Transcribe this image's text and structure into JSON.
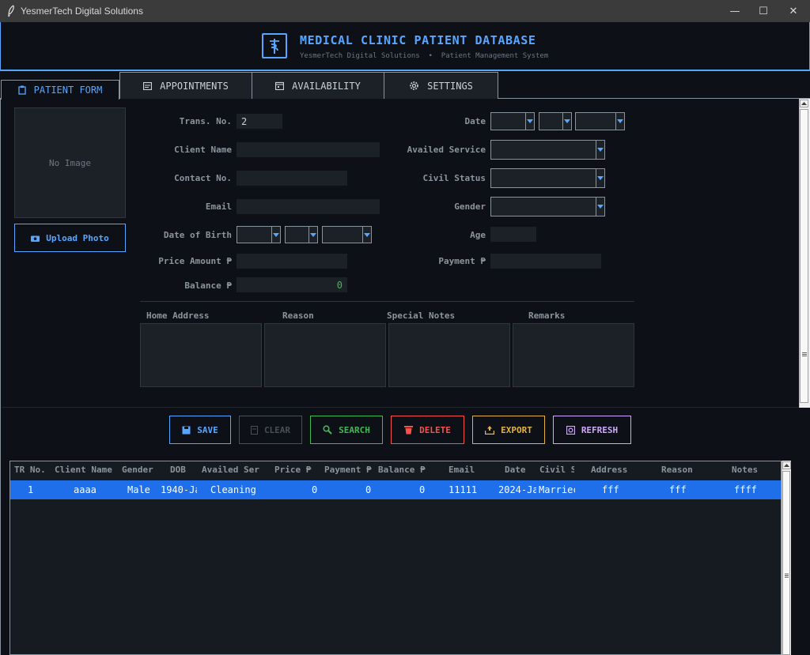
{
  "window": {
    "title": "YesmerTech Digital Solutions",
    "minimize": "—",
    "maximize": "☐",
    "close": "✕"
  },
  "header": {
    "title": "MEDICAL CLINIC PATIENT DATABASE",
    "subtitle": "YesmerTech Digital Solutions  •  Patient Management System"
  },
  "tabs": [
    {
      "label": "PATIENT FORM",
      "icon": "clipboard-icon"
    },
    {
      "label": "APPOINTMENTS",
      "icon": "card-icon"
    },
    {
      "label": "AVAILABILITY",
      "icon": "calendar-icon"
    },
    {
      "label": "SETTINGS",
      "icon": "gear-icon"
    }
  ],
  "photo": {
    "placeholder": "No Image",
    "upload_label": "Upload Photo"
  },
  "form": {
    "trans_no": {
      "label": "Trans. No.",
      "value": "2"
    },
    "client_name": {
      "label": "Client Name",
      "value": ""
    },
    "contact_no": {
      "label": "Contact No.",
      "value": ""
    },
    "email": {
      "label": "Email",
      "value": ""
    },
    "dob": {
      "label": "Date of Birth"
    },
    "price_amount": {
      "label": "Price Amount ₱",
      "value": ""
    },
    "balance": {
      "label": "Balance ₱",
      "value": "0"
    },
    "date": {
      "label": "Date"
    },
    "availed_service": {
      "label": "Availed Service"
    },
    "civil_status": {
      "label": "Civil Status"
    },
    "gender": {
      "label": "Gender"
    },
    "age": {
      "label": "Age",
      "value": ""
    },
    "payment": {
      "label": "Payment ₱",
      "value": ""
    }
  },
  "text_areas": {
    "home_address": "Home Address",
    "reason": "Reason",
    "special_notes": "Special Notes",
    "remarks": "Remarks"
  },
  "actions": {
    "save": "SAVE",
    "clear": "CLEAR",
    "search": "SEARCH",
    "delete": "DELETE",
    "export": "EXPORT",
    "refresh": "REFRESH"
  },
  "colors": {
    "accent": "#58a6ff",
    "save": "#58a6ff",
    "clear": "#484f58",
    "search": "#3fb950",
    "delete": "#f85149",
    "export": "#e3b341",
    "refresh": "#d2a8ff",
    "selected_row": "#1f6feb"
  },
  "table": {
    "columns": [
      "TR No.",
      "Client Name",
      "Gender",
      "DOB",
      "Availed Ser",
      "Price ₱",
      "Payment ₱",
      "Balance ₱",
      "Email",
      "Date",
      "Civil S",
      "Address",
      "Reason",
      "Notes"
    ],
    "rows": [
      [
        "1",
        "aaaa",
        "Male",
        "1940-Ja",
        "Cleaning",
        "0",
        "0",
        "0",
        "11111",
        "2024-Ja",
        "Marriec",
        "fff",
        "fff",
        "ffff"
      ]
    ]
  }
}
